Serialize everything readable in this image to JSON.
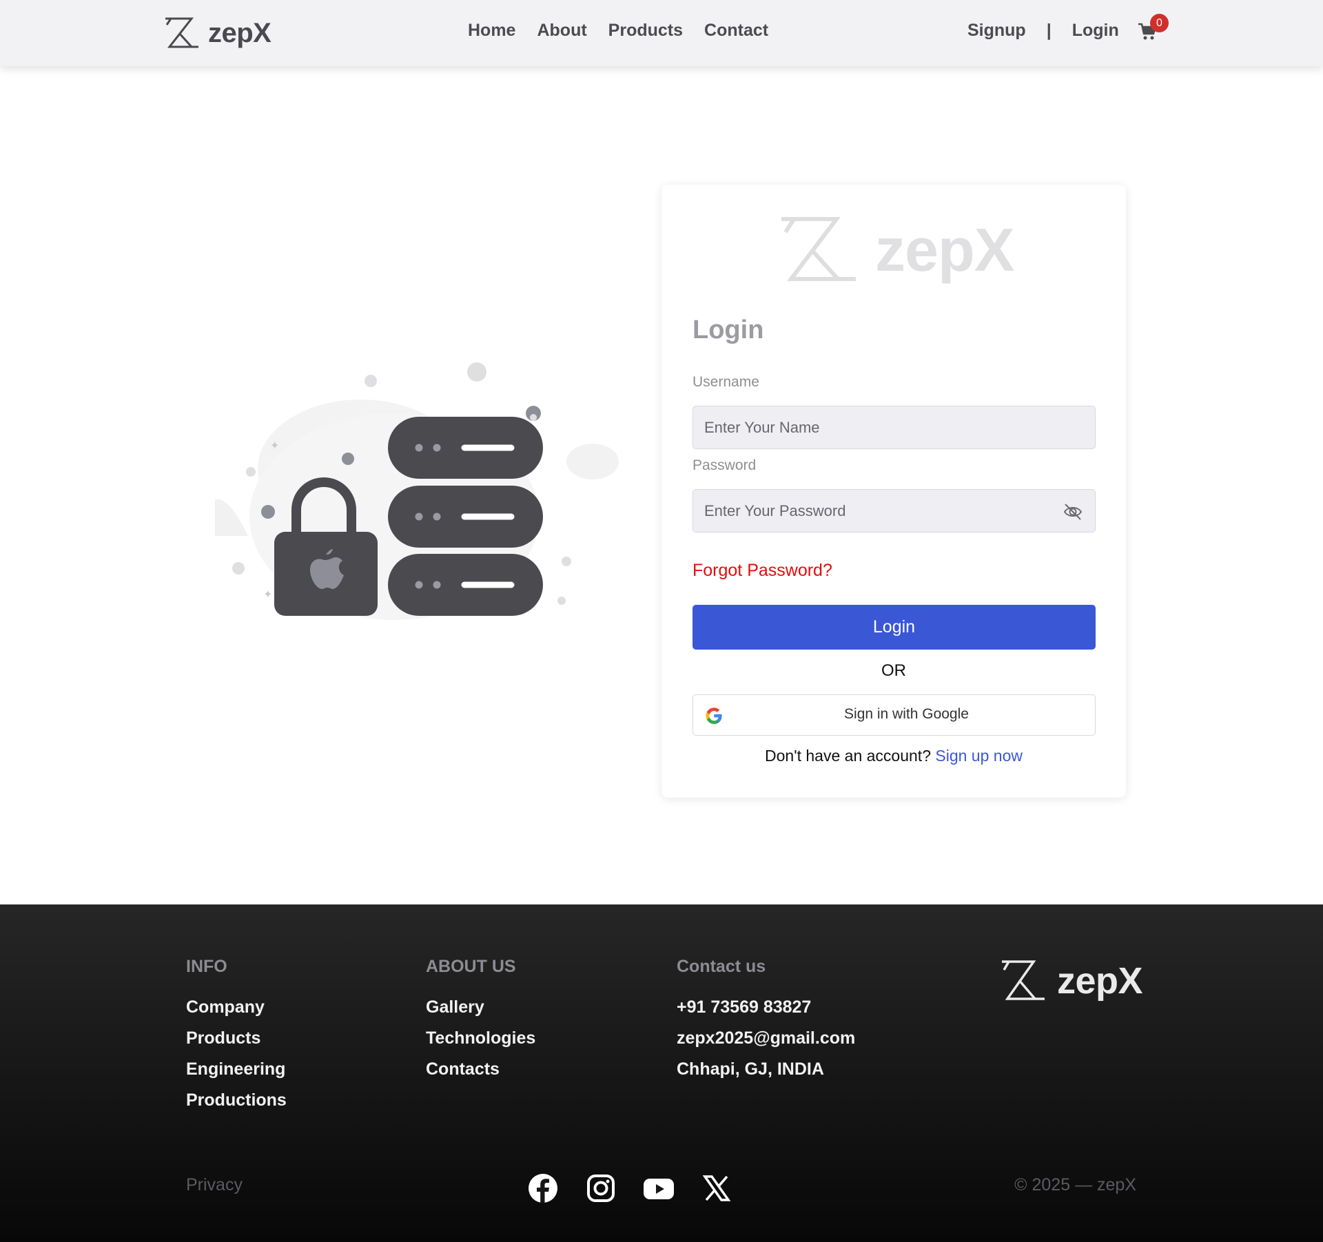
{
  "brand": {
    "name": "zepX"
  },
  "nav": {
    "links": [
      "Home",
      "About",
      "Products",
      "Contact"
    ],
    "signup": "Signup",
    "separator": "|",
    "login": "Login",
    "cart_count": "0"
  },
  "login_card": {
    "logo_text": "zepX",
    "title": "Login",
    "username_label": "Username",
    "username_placeholder": "Enter Your Name",
    "password_label": "Password",
    "password_placeholder": "Enter Your Password",
    "forgot": "Forgot Password?",
    "submit": "Login",
    "or": "OR",
    "google": "Sign in with Google",
    "no_account": "Don't have an account?",
    "signup_link": "Sign up now"
  },
  "footer": {
    "info": {
      "heading": "INFO",
      "items": [
        "Company",
        "Products",
        "Engineering",
        "Productions"
      ]
    },
    "about": {
      "heading": "ABOUT US",
      "items": [
        "Gallery",
        "Technologies",
        "Contacts"
      ]
    },
    "contact": {
      "heading": "Contact us",
      "items": [
        "+91 73569 83827",
        "zepx2025@gmail.com",
        "Chhapi, GJ, INDIA"
      ]
    },
    "logo_text": "zepX",
    "privacy": "Privacy",
    "socials": [
      "facebook-icon",
      "instagram-icon",
      "youtube-icon",
      "x-icon"
    ],
    "copyright": "© 2025 — zepX"
  },
  "colors": {
    "primary": "#3a57d6",
    "danger": "#e50c0c",
    "badge": "#d0302b"
  }
}
